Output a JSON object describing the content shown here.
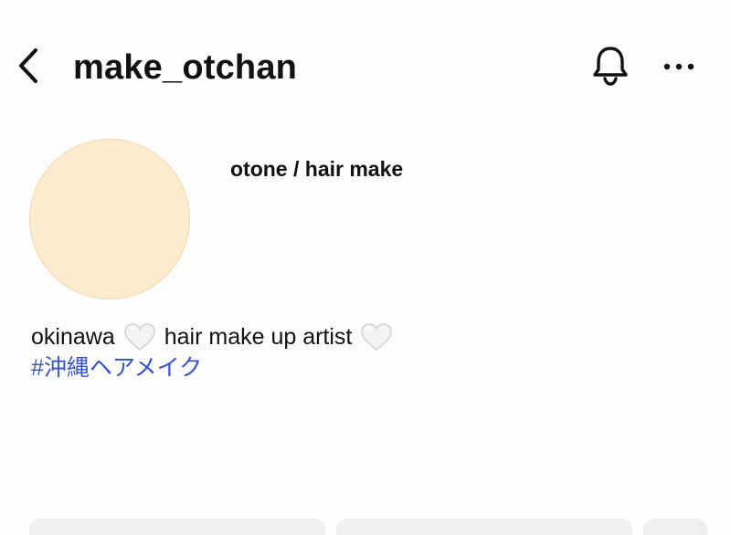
{
  "header": {
    "username": "make_otchan",
    "back_icon": "chevron-left-icon",
    "bell_icon": "bell-icon",
    "more_icon": "more-horizontal-icon"
  },
  "profile": {
    "display_name": "otone / hair make",
    "avatar_color": "#fdeccd",
    "bio": {
      "part1": "okinawa",
      "part2": "hair make up artist",
      "heart_icon": "white-heart-icon",
      "hashtag": "#沖縄ヘアメイク"
    }
  },
  "colors": {
    "text": "#111111",
    "link": "#3552c8",
    "button_bg": "#efeff2"
  }
}
